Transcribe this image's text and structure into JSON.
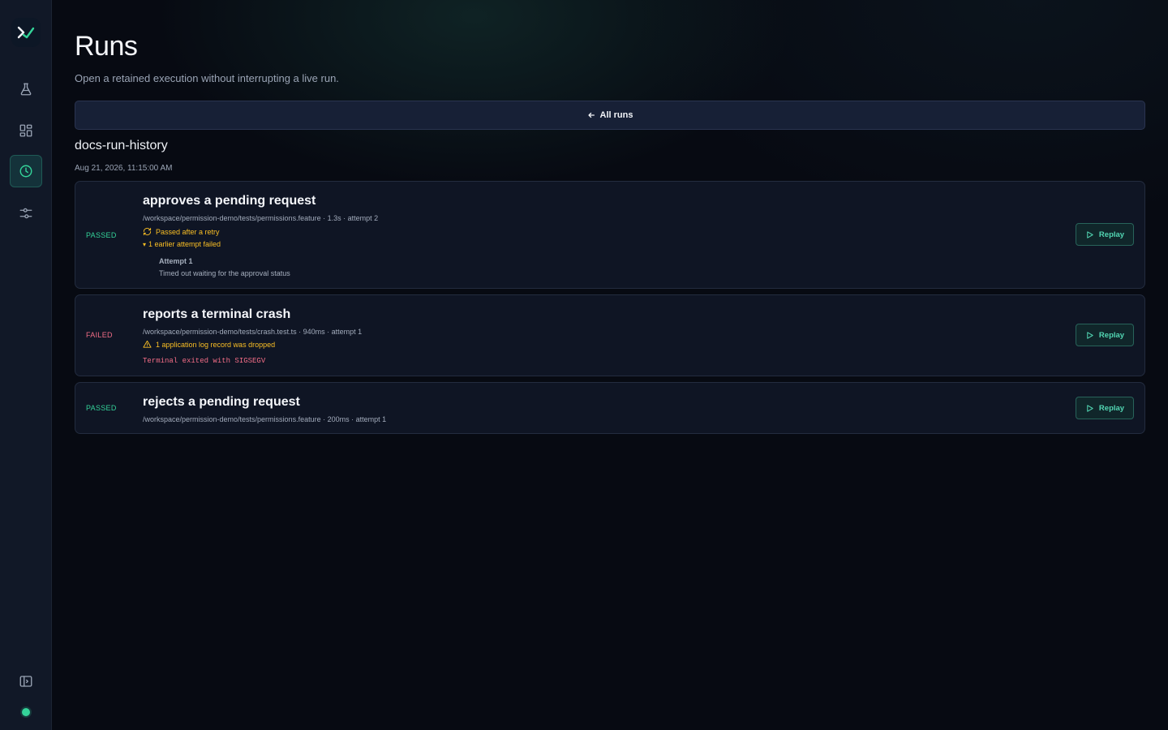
{
  "sidebar": {
    "logo_icon": "logo-icon",
    "items": [
      {
        "icon": "flask-icon",
        "name": "tests"
      },
      {
        "icon": "grid-icon",
        "name": "dashboard"
      },
      {
        "icon": "clock-icon",
        "name": "runs",
        "active": true
      },
      {
        "icon": "sliders-icon",
        "name": "settings"
      }
    ],
    "collapse_icon": "sidebar-toggle-icon",
    "status_color": "#34d399"
  },
  "header": {
    "title": "Runs",
    "subtitle": "Open a retained execution without interrupting a live run."
  },
  "all_runs_label": "All runs",
  "run": {
    "name": "docs-run-history",
    "date": "Aug 21, 2026, 11:15:00 AM"
  },
  "tests": [
    {
      "status": "PASSED",
      "title": "approves a pending request",
      "meta": "/workspace/permission-demo/tests/permissions.feature · 1.3s · attempt 2",
      "retry_note": "Passed after a retry",
      "earlier_attempts": "1 earlier attempt failed",
      "attempt_title": "Attempt 1",
      "attempt_message": "Timed out waiting for the approval status",
      "replay_label": "Replay"
    },
    {
      "status": "FAILED",
      "title": "reports a terminal crash",
      "meta": "/workspace/permission-demo/tests/crash.test.ts · 940ms · attempt 1",
      "warning_note": "1 application log record was dropped",
      "error": "Terminal exited with SIGSEGV",
      "replay_label": "Replay"
    },
    {
      "status": "PASSED",
      "title": "rejects a pending request",
      "meta": "/workspace/permission-demo/tests/permissions.feature · 200ms · attempt 1",
      "replay_label": "Replay"
    }
  ],
  "colors": {
    "accent": "#34d399",
    "passed": "#34d399",
    "failed": "#f26d86",
    "warning": "#fbbf24"
  }
}
